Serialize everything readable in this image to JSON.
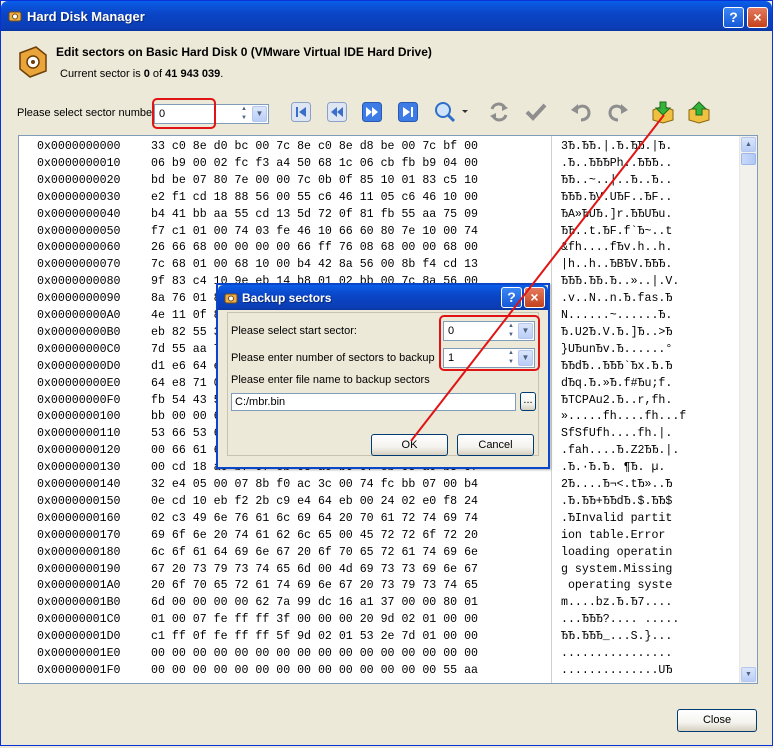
{
  "window": {
    "title": "Hard Disk Manager",
    "help_label": "?",
    "close_label": "×"
  },
  "header": {
    "title": "Edit sectors on Basic Hard Disk 0 (VMware Virtual IDE Hard Drive)",
    "current_prefix": "Current sector is ",
    "current_sector": "0",
    "of_label": " of ",
    "total_sectors": "41 943 039",
    "period": "."
  },
  "sector_select": {
    "label": "Please select sector number",
    "value": "0"
  },
  "icons": {
    "first": "first-sector-icon",
    "prev": "previous-sector-icon",
    "next": "next-sector-icon",
    "last": "last-sector-icon",
    "search": "search-icon",
    "refresh": "refresh-icon",
    "apply": "checkmark-icon",
    "undo": "undo-icon",
    "redo": "redo-icon",
    "backup": "backup-sectors-icon",
    "restore": "restore-sectors-icon"
  },
  "colors": {
    "title_blue": "#0a46c8",
    "highlight_red": "#e01414",
    "window_bg": "#ece9d8"
  },
  "hex_rows": [
    {
      "addr": "0x0000000000",
      "bytes": "33 c0 8e d0 bc 00 7c 8e c0 8e d8 be 00 7c bf 00",
      "ascii": "3Ђ.ЂЂ.|.Ђ.ЂЂ.|Ђ."
    },
    {
      "addr": "0x0000000010",
      "bytes": "06 b9 00 02 fc f3 a4 50 68 1c 06 cb fb b9 04 00",
      "ascii": ".Ђ..ЂЂЂPh..ЂЂЂ.."
    },
    {
      "addr": "0x0000000020",
      "bytes": "bd be 07 80 7e 00 00 7c 0b 0f 85 10 01 83 c5 10",
      "ascii": "ЂЂ..~..|..Ђ..Ђ.."
    },
    {
      "addr": "0x0000000030",
      "bytes": "e2 f1 cd 18 88 56 00 55 c6 46 11 05 c6 46 10 00",
      "ascii": "ЂЂЂ.ЂV.UЂF..ЂF.."
    },
    {
      "addr": "0x0000000040",
      "bytes": "b4 41 bb aa 55 cd 13 5d 72 0f 81 fb 55 aa 75 09",
      "ascii": "ЂA»ЂUЂ.]r.ЂЂUЂu."
    },
    {
      "addr": "0x0000000050",
      "bytes": "f7 c1 01 00 74 03 fe 46 10 66 60 80 7e 10 00 74",
      "ascii": "ЂЂ..t.ЂF.f`Ђ~..t"
    },
    {
      "addr": "0x0000000060",
      "bytes": "26 66 68 00 00 00 00 66 ff 76 08 68 00 00 68 00",
      "ascii": "&fh....fЂv.h..h."
    },
    {
      "addr": "0x0000000070",
      "bytes": "7c 68 01 00 68 10 00 b4 42 8a 56 00 8b f4 cd 13",
      "ascii": "|h..h..ЂBЂV.ЂЂЂ."
    },
    {
      "addr": "0x0000000080",
      "bytes": "9f 83 c4 10 9e eb 14 b8 01 02 bb 00 7c 8a 56 00",
      "ascii": "ЂЂЂ.ЂЂ.Ђ..»..|.V."
    },
    {
      "addr": "0x0000000090",
      "bytes": "8a 76 01 8a 4e 02 8a 6e 03 cd 13 66 61 73 1c fe",
      "ascii": ".v..N..n.Ђ.fas.Ђ"
    },
    {
      "addr": "0x00000000A0",
      "bytes": "4e 11 0f 85 0c 00 80 7e 00 80 0f 84 8a 00 b2 80",
      "ascii": "N......~......Ђ."
    },
    {
      "addr": "0x00000000B0",
      "bytes": "eb 82 55 32 e4 8a 56 00 cd 13 5d eb 9c 81 3e fe",
      "ascii": "Ђ.U2Ђ.V.Ђ.]Ђ..>Ђ"
    },
    {
      "addr": "0x00000000C0",
      "bytes": "7d 55 aa 75 6e ff 76 00 e8 8a 00 0f 85 15 00 b0",
      "ascii": "}UЂunЂv.Ђ......°"
    },
    {
      "addr": "0x00000000D0",
      "bytes": "d1 e6 64 e8 7f 00 b0 df e6 60 e8 78 00 b0 ff e6",
      "ascii": "ЂЂdЂ..ЂЂЂ`Ђx.Ђ.Ђ"
    },
    {
      "addr": "0x00000000E0",
      "bytes": "64 e8 71 00 b8 00 bb cd 1a 66 23 c0 75 3b 66 81",
      "ascii": "dЂq.Ђ.»Ђ.f#Ђu;f."
    },
    {
      "addr": "0x00000000F0",
      "bytes": "fb 54 43 50 41 75 32 81 f9 02 01 72 2c 66 68 07",
      "ascii": "ЂTCPAu2.Ђ..r,fh."
    },
    {
      "addr": "0x0000000100",
      "bytes": "bb 00 00 66 68 00 02 00 00 66 68 08 00 00 00 66",
      "ascii": "».....fh....fh...f"
    },
    {
      "addr": "0x0000000110",
      "bytes": "53 66 53 66 55 66 68 00 00 00 00 66 68 00 7c 00",
      "ascii": "SfSfUfh....fh.|."
    },
    {
      "addr": "0x0000000120",
      "bytes": "00 66 61 68 00 00 07 cd 1a 5a 32 f6 ea 00 7c 00",
      "ascii": ".fah....Ђ.Z2ЂЂ.|."
    },
    {
      "addr": "0x0000000130",
      "bytes": "00 cd 18 a0 b7 07 eb 08 a0 b6 07 eb 03 a0 b5 07",
      "ascii": ".Ђ.·Ђ.Ђ. ¶Ђ. µ."
    },
    {
      "addr": "0x0000000140",
      "bytes": "32 e4 05 00 07 8b f0 ac 3c 00 74 fc bb 07 00 b4",
      "ascii": "2Ђ....Ђ¬<.tЂ»..Ђ"
    },
    {
      "addr": "0x0000000150",
      "bytes": "0e cd 10 eb f2 2b c9 e4 64 eb 00 24 02 e0 f8 24",
      "ascii": ".Ђ.ЂЂ+ЂЂdЂ.$.ЂЂ$"
    },
    {
      "addr": "0x0000000160",
      "bytes": "02 c3 49 6e 76 61 6c 69 64 20 70 61 72 74 69 74",
      "ascii": ".ЂInvalid partit"
    },
    {
      "addr": "0x0000000170",
      "bytes": "69 6f 6e 20 74 61 62 6c 65 00 45 72 72 6f 72 20",
      "ascii": "ion table.Error "
    },
    {
      "addr": "0x0000000180",
      "bytes": "6c 6f 61 64 69 6e 67 20 6f 70 65 72 61 74 69 6e",
      "ascii": "loading operatin"
    },
    {
      "addr": "0x0000000190",
      "bytes": "67 20 73 79 73 74 65 6d 00 4d 69 73 73 69 6e 67",
      "ascii": "g system.Missing"
    },
    {
      "addr": "0x00000001A0",
      "bytes": "20 6f 70 65 72 61 74 69 6e 67 20 73 79 73 74 65",
      "ascii": " operating syste"
    },
    {
      "addr": "0x00000001B0",
      "bytes": "6d 00 00 00 00 62 7a 99 dc 16 a1 37 00 00 80 01",
      "ascii": "m....bz.Ђ.Ђ7...."
    },
    {
      "addr": "0x00000001C0",
      "bytes": "01 00 07 fe ff ff 3f 00 00 00 20 9d 02 01 00 00",
      "ascii": "...ЂЂЂ?.... ....."
    },
    {
      "addr": "0x00000001D0",
      "bytes": "c1 ff 0f fe ff ff 5f 9d 02 01 53 2e 7d 01 00 00",
      "ascii": "ЂЂ.ЂЂЂ_...S.}..."
    },
    {
      "addr": "0x00000001E0",
      "bytes": "00 00 00 00 00 00 00 00 00 00 00 00 00 00 00 00",
      "ascii": "................"
    },
    {
      "addr": "0x00000001F0",
      "bytes": "00 00 00 00 00 00 00 00 00 00 00 00 00 00 55 aa",
      "ascii": "..............UЂ"
    }
  ],
  "scroll_up": "▲",
  "scroll_down": "▼",
  "close_button": "Close",
  "dialog": {
    "title": "Backup sectors",
    "help_label": "?",
    "close_label": "×",
    "start_label": "Please select start sector:",
    "start_value": "0",
    "count_label": "Please enter number of sectors to backup",
    "count_value": "1",
    "file_label": "Please enter file name to backup sectors",
    "file_value": "C:/mbr.bin",
    "browse_label": "...",
    "ok_label": "OK",
    "cancel_label": "Cancel"
  }
}
